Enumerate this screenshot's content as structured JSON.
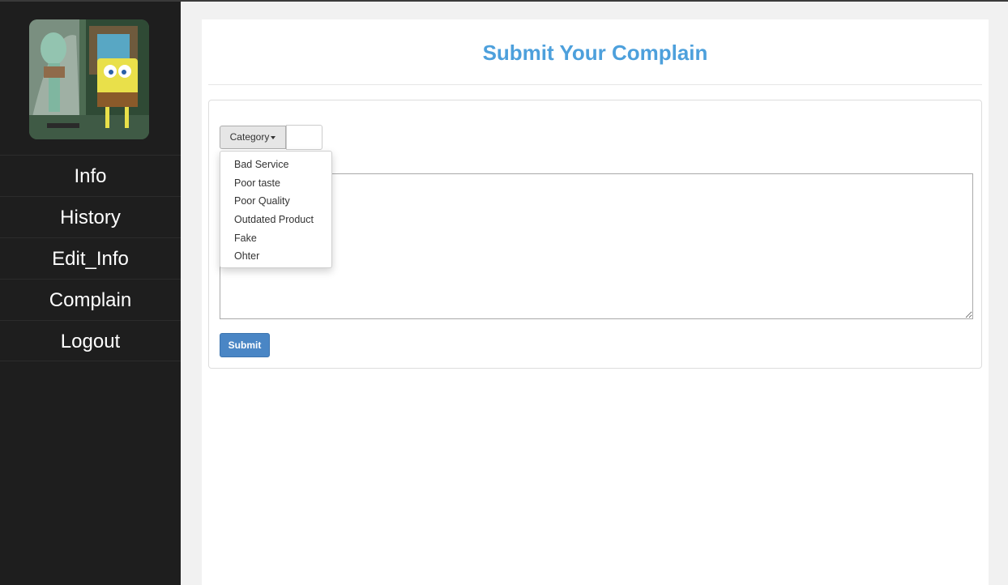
{
  "sidebar": {
    "avatar": {
      "alt": "profile-picture"
    },
    "items": [
      {
        "label": "Info"
      },
      {
        "label": "History"
      },
      {
        "label": "Edit_Info"
      },
      {
        "label": "Complain"
      },
      {
        "label": "Logout"
      }
    ]
  },
  "main": {
    "title": "Submit Your Complain",
    "form": {
      "category_button": "Category",
      "category_input_value": "",
      "section_label_visible": "nt",
      "textarea_value": "",
      "submit_label": "Submit"
    },
    "dropdown": {
      "options": [
        {
          "label": "Bad Service"
        },
        {
          "label": "Poor taste"
        },
        {
          "label": "Poor Quality"
        },
        {
          "label": "Outdated Product"
        },
        {
          "label": "Fake"
        },
        {
          "label": "Ohter"
        }
      ]
    }
  },
  "colors": {
    "sidebar_bg": "#1e1e1e",
    "accent": "#4da0dc",
    "submit": "#4a86c5",
    "page_bg": "#f1f1f1"
  }
}
